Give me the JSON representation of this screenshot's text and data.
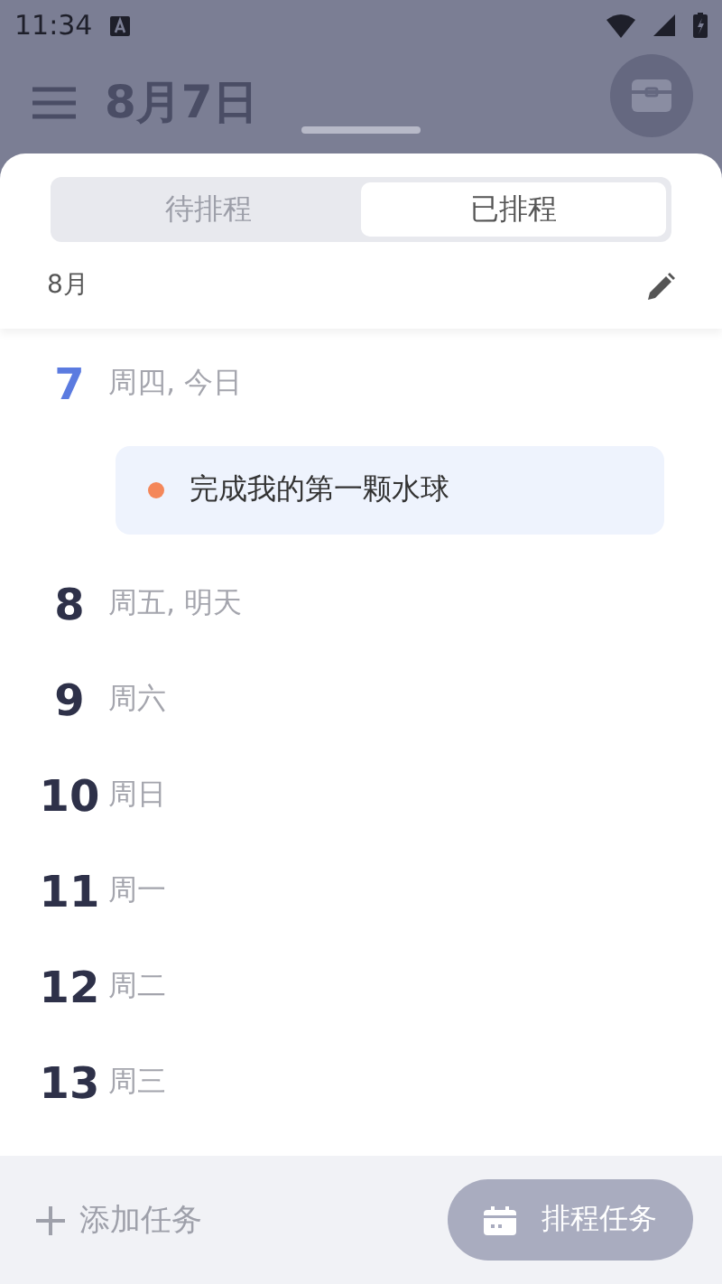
{
  "status_bar": {
    "time": "11:34"
  },
  "header": {
    "title": "8月7日"
  },
  "tabs": [
    {
      "label": "待排程",
      "selected": false
    },
    {
      "label": "已排程",
      "selected": true
    }
  ],
  "month": "8月",
  "days": [
    {
      "day": "7",
      "label": "周四, 今日",
      "today": true,
      "tasks": [
        {
          "title": "完成我的第一颗水球",
          "color": "#f4875a"
        }
      ]
    },
    {
      "day": "8",
      "label": "周五, 明天",
      "today": false
    },
    {
      "day": "9",
      "label": "周六",
      "today": false
    },
    {
      "day": "10",
      "label": "周日",
      "today": false
    },
    {
      "day": "11",
      "label": "周一",
      "today": false
    },
    {
      "day": "12",
      "label": "周二",
      "today": false
    },
    {
      "day": "13",
      "label": "周三",
      "today": false
    }
  ],
  "bottom_bar": {
    "add_label": "添加任务",
    "schedule_button": "排程任务"
  }
}
